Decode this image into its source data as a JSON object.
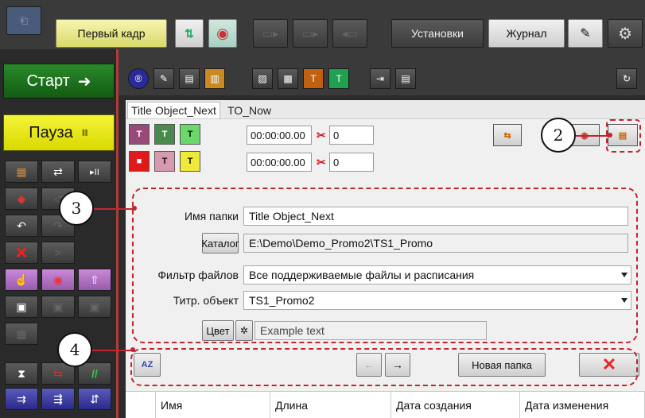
{
  "topbar": {
    "first_frame_label": "Первый кадр",
    "settings_label": "Установки",
    "journal_label": "Журнал",
    "icons": [
      "frame-icon",
      "pin-icon",
      "clock-icon",
      "monitor-icon",
      "monitor-arrow-icon",
      "monitor-back-icon",
      "pen-icon",
      "gear-icon"
    ]
  },
  "left_panel": {
    "start_label": "Старт",
    "start_arrow": "➜",
    "pause_label": "Пауза",
    "pause_symbol": "⏸"
  },
  "tabs": [
    {
      "label": "Title Object_Next",
      "active": true
    },
    {
      "label": "TO_Now",
      "active": false
    }
  ],
  "timing": {
    "row1": {
      "time": "00:00:00.00",
      "count": "0"
    },
    "row2": {
      "time": "00:00:00.00",
      "count": "0"
    }
  },
  "form": {
    "folder_name_label": "Имя папки",
    "folder_name_value": "Title Object_Next",
    "catalog_button": "Каталог",
    "catalog_path": "E:\\Demo\\Demo_Promo2\\TS1_Promo",
    "filter_label": "Фильтр файлов",
    "filter_value": "Все поддерживаемые файлы и расписания",
    "title_object_label": "Титр. объект",
    "title_object_value": "TS1_Promo2",
    "color_button": "Цвет",
    "example_text": "Example text"
  },
  "toolbar2": {
    "sort_label": "AZ",
    "new_folder_label": "Новая папка"
  },
  "grid": {
    "columns": [
      "Имя",
      "Длина",
      "Дата создания",
      "Дата изменения"
    ]
  },
  "callouts": {
    "c2": "2",
    "c3": "3",
    "c4": "4"
  },
  "colors": {
    "accent_red": "#c0272d",
    "start_green": "#1f7a1f",
    "pause_yellow": "#e8e800"
  }
}
